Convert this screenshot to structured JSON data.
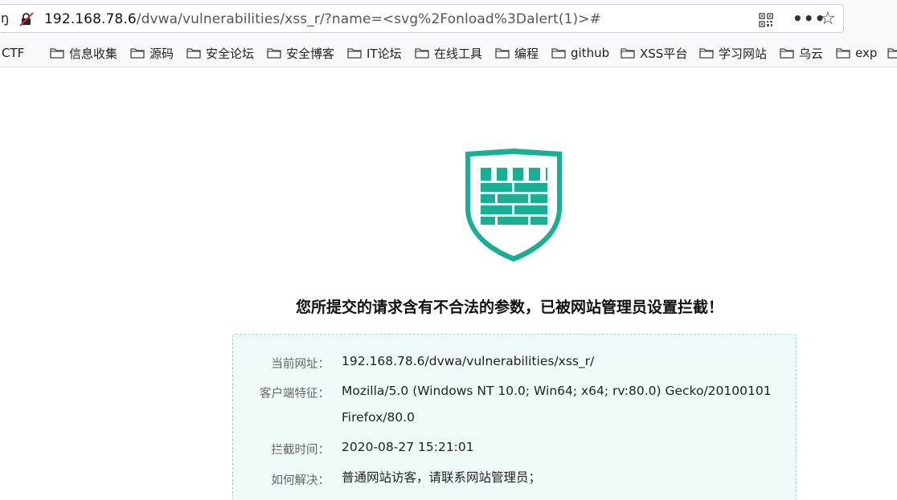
{
  "address_bar": {
    "left_fragment": "ŋ",
    "url_host": "192.168.78.6",
    "url_path": "/dvwa/vulnerabilities/xss_r/?name=<svg%2Fonload%3Dalert(1)>#",
    "icons": [
      "insecure-connection-icon",
      "qr-code-icon",
      "more-icon",
      "bookmark-star-icon"
    ],
    "more_glyph": "•••",
    "star_glyph": "☆"
  },
  "bookmarks": [
    {
      "label": "CTF"
    },
    {
      "label": "信息收集"
    },
    {
      "label": "源码"
    },
    {
      "label": "安全论坛"
    },
    {
      "label": "安全博客"
    },
    {
      "label": "IT论坛"
    },
    {
      "label": "在线工具"
    },
    {
      "label": "编程"
    },
    {
      "label": "github"
    },
    {
      "label": "XSS平台"
    },
    {
      "label": "学习网站"
    },
    {
      "label": "乌云"
    },
    {
      "label": "exp"
    }
  ],
  "block_page": {
    "headline": "您所提交的请求含有不合法的参数，已被网站管理员设置拦截！",
    "rows": [
      {
        "label": "当前网址：",
        "value": "192.168.78.6/dvwa/vulnerabilities/xss_r/"
      },
      {
        "label": "客户端特征：",
        "value": "Mozilla/5.0 (Windows NT 10.0; Win64; x64; rv:80.0) Gecko/20100101 Firefox/80.0"
      },
      {
        "label": "拦截时间：",
        "value": "2020-08-27 15:21:01"
      },
      {
        "label": "如何解决：",
        "value": "普通网站访客，请联系网站管理员；"
      }
    ],
    "colors": {
      "shield": "#1aae94",
      "box_bg": "#eefbfa",
      "box_border": "#9fd8d3"
    }
  }
}
